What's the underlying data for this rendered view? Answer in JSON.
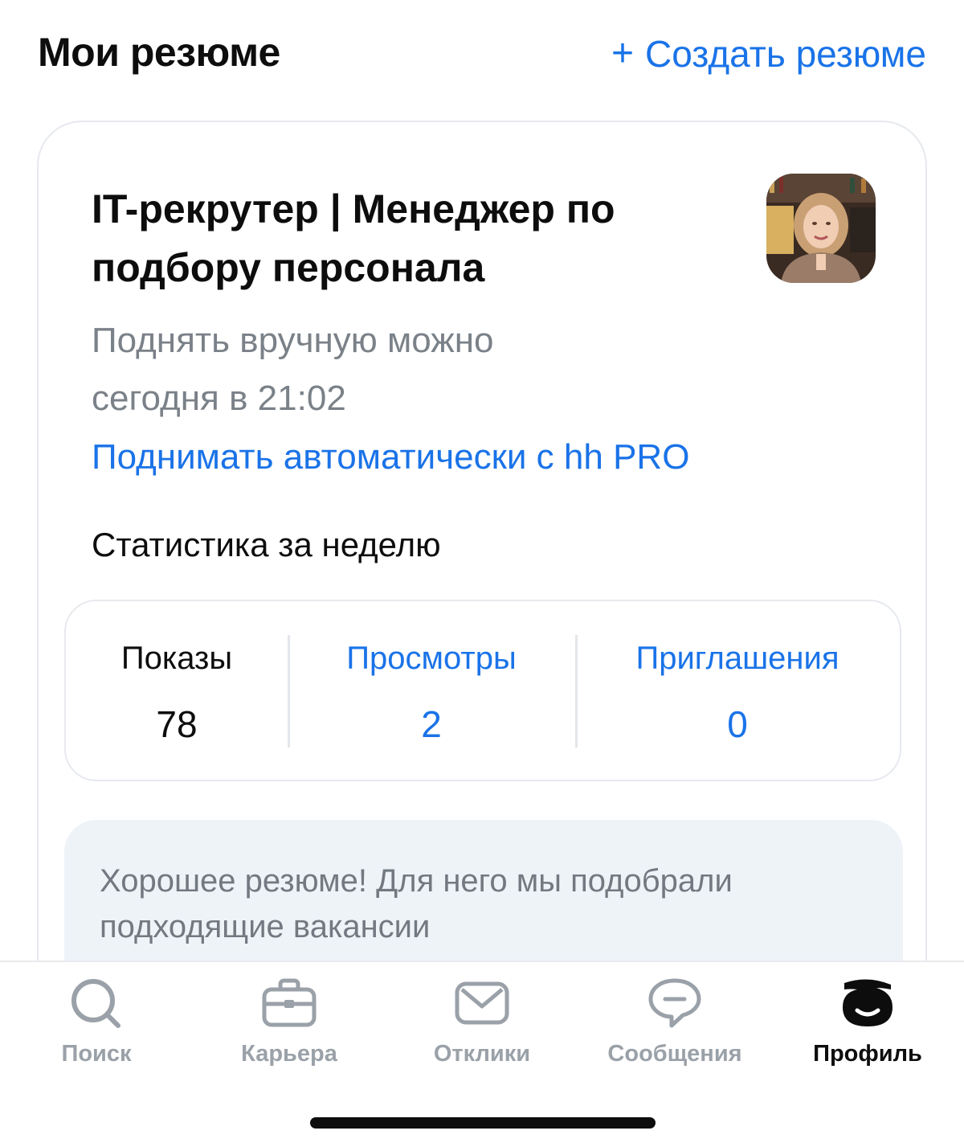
{
  "header": {
    "title": "Мои резюме",
    "create_label": "Создать резюме",
    "create_icon": "plus-icon"
  },
  "resume": {
    "title": "IT-рекрутер | Менеджер по подбору персонала",
    "lift_note_line1": "Поднять вручную можно",
    "lift_note_line2": "сегодня в 21:02",
    "pro_link": "Поднимать автоматически с hh PRO",
    "stats_heading": "Статистика за неделю",
    "stats": [
      {
        "label": "Показы",
        "value": "78"
      },
      {
        "label": "Просмотры",
        "value": "2"
      },
      {
        "label": "Приглашения",
        "value": "0"
      }
    ],
    "good_note": "Хорошее резюме! Для него мы подобрали подходящие вакансии"
  },
  "tabbar": {
    "items": [
      {
        "label": "Поиск",
        "icon": "search-icon"
      },
      {
        "label": "Карьера",
        "icon": "briefcase-icon"
      },
      {
        "label": "Отклики",
        "icon": "envelope-icon"
      },
      {
        "label": "Сообщения",
        "icon": "chat-bubble-icon"
      },
      {
        "label": "Профиль",
        "icon": "hh-profile-icon"
      }
    ],
    "active": "Профиль"
  },
  "colors": {
    "accent": "#1a73e8",
    "muted_text": "#7a8188",
    "tab_inactive": "#9aa1a8",
    "note_background": "#eef3f8"
  }
}
